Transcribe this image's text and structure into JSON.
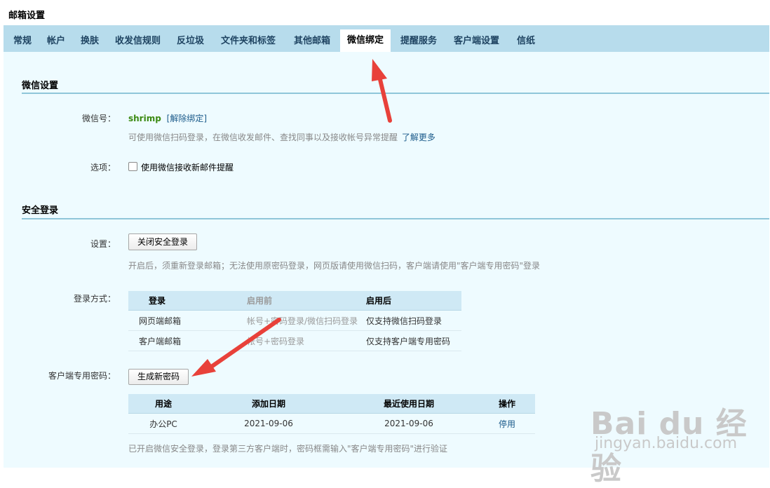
{
  "page_title": "邮箱设置",
  "tabs": [
    {
      "label": "常规"
    },
    {
      "label": "帐户"
    },
    {
      "label": "换肤"
    },
    {
      "label": "收发信规则"
    },
    {
      "label": "反垃圾"
    },
    {
      "label": "文件夹和标签"
    },
    {
      "label": "其他邮箱"
    },
    {
      "label": "微信绑定",
      "active": true
    },
    {
      "label": "提醒服务"
    },
    {
      "label": "客户端设置"
    },
    {
      "label": "信纸"
    }
  ],
  "wechat": {
    "section_title": "微信设置",
    "account_label": "微信号：",
    "account_value": "shrimp",
    "unbind_link": "[解除绑定]",
    "hint": "可使用微信扫码登录，在微信收发邮件、查找同事以及接收帐号异常提醒",
    "learn_more": "了解更多",
    "options_label": "选项：",
    "option_checkbox_label": "使用微信接收新邮件提醒",
    "option_checked": false
  },
  "secure": {
    "section_title": "安全登录",
    "setting_label": "设置：",
    "close_button": "关闭安全登录",
    "setting_hint": "开启后，须重新登录邮箱；无法使用原密码登录，网页版请使用微信扫码，客户端请使用\"客户端专用密码\"登录",
    "login_method_label": "登录方式：",
    "login_table": {
      "headers": [
        "登录",
        "启用前",
        "启用后"
      ],
      "rows": [
        [
          "网页端邮箱",
          "帐号+密码登录/微信扫码登录",
          "仅支持微信扫码登录"
        ],
        [
          "客户端邮箱",
          "帐号+密码登录",
          "仅支持客户端专用密码"
        ]
      ]
    },
    "client_pwd_label": "客户端专用密码：",
    "generate_button": "生成新密码",
    "pwd_table": {
      "headers": [
        "用途",
        "添加日期",
        "最近使用日期",
        "操作"
      ],
      "rows": [
        [
          "办公PC",
          "2021-09-06",
          "2021-09-06",
          "停用"
        ]
      ]
    },
    "footer_hint": "已开启微信安全登录，登录第三方客户端时，密码框需输入\"客户端专用密码\"进行验证"
  },
  "watermark": {
    "logo_text": "Bai du 经验",
    "url": "jingyan.baidu.com"
  },
  "colors": {
    "tab_bar": "#b7dcec",
    "content_bg": "#eefbff",
    "arrow": "#e8413a",
    "link": "#1a5a8a",
    "account_green": "#3b8a12"
  }
}
